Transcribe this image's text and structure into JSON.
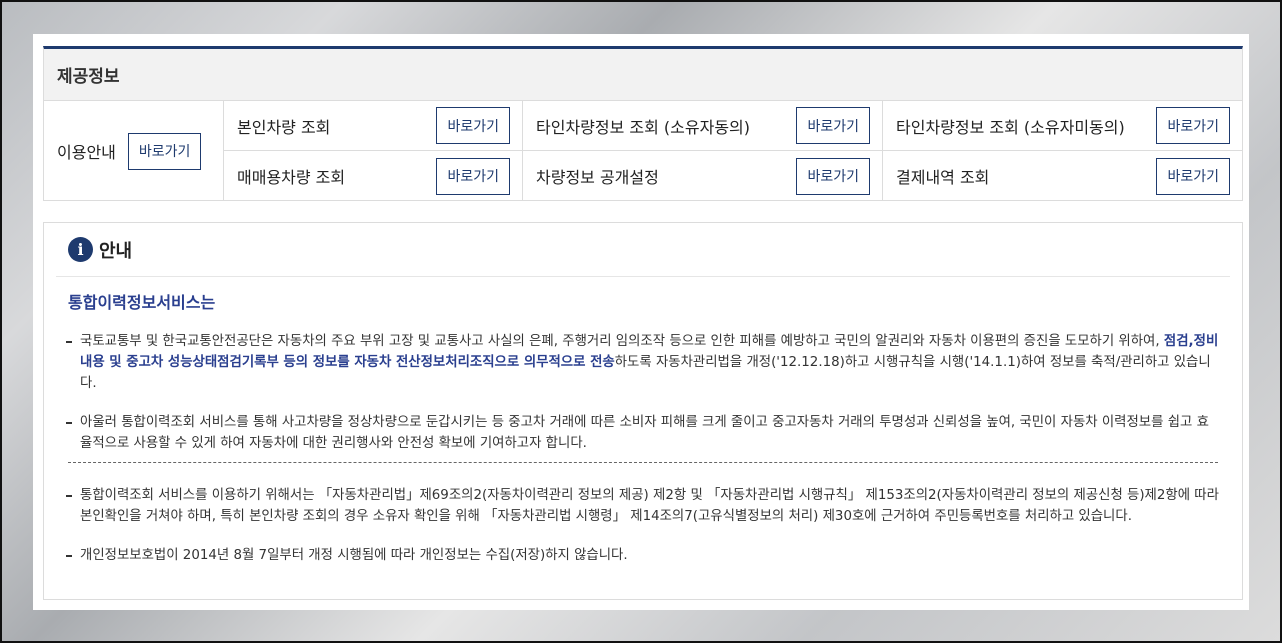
{
  "provision": {
    "title": "제공정보",
    "guide": {
      "label": "이용안내",
      "button": "바로가기"
    },
    "cells": [
      {
        "label": "본인차량 조회",
        "button": "바로가기"
      },
      {
        "label": "타인차량정보 조회 (소유자동의)",
        "button": "바로가기"
      },
      {
        "label": "타인차량정보 조회 (소유자미동의)",
        "button": "바로가기"
      },
      {
        "label": "매매용차량 조회",
        "button": "바로가기"
      },
      {
        "label": "차량정보 공개설정",
        "button": "바로가기"
      },
      {
        "label": "결제내역 조회",
        "button": "바로가기"
      }
    ]
  },
  "notice": {
    "icon": "info-icon",
    "icon_glyph": "i",
    "title": "안내",
    "subtitle": "통합이력정보서비스는",
    "items": [
      {
        "pre": "국토교통부 및 한국교통안전공단은 자동차의 주요 부위 고장 및 교통사고 사실의 은폐, 주행거리 임의조작 등으로 인한 피해를 예방하고 국민의 알권리와 자동차 이용편의 증진을 도모하기 위하여, ",
        "highlight": "점검,정비 내용 및 중고차 성능상태점검기록부 등의 정보를 자동차 전산정보처리조직으로 의무적으로 전송",
        "post": "하도록 자동차관리법을 개정('12.12.18)하고 시행규칙을 시행('14.1.1)하여 정보를 축적/관리하고 있습니다."
      },
      {
        "text": "아울러 통합이력조회 서비스를 통해 사고차량을 정상차량으로 둔갑시키는 등 중고차 거래에 따른 소비자 피해를 크게 줄이고 중고자동차 거래의 투명성과 신뢰성을 높여, 국민이 자동차 이력정보를 쉽고 효율적으로 사용할 수 있게 하여 자동차에 대한 권리행사와 안전성 확보에 기여하고자 합니다."
      },
      {
        "text": "통합이력조회 서비스를 이용하기 위해서는 「자동차관리법」제69조의2(자동차이력관리 정보의 제공) 제2항 및 「자동차관리법 시행규칙」 제153조의2(자동차이력관리 정보의 제공신청 등)제2항에 따라 본인확인을 거쳐야 하며, 특히 본인차량 조회의 경우 소유자 확인을 위해 「자동차관리법 시행령」 제14조의7(고유식별정보의 처리) 제30호에 근거하여 주민등록번호를 처리하고 있습니다."
      },
      {
        "text": "개인정보보호법이 2014년 8월 7일부터 개정 시행됨에 따라 개인정보는 수집(저장)하지 않습니다."
      }
    ]
  }
}
